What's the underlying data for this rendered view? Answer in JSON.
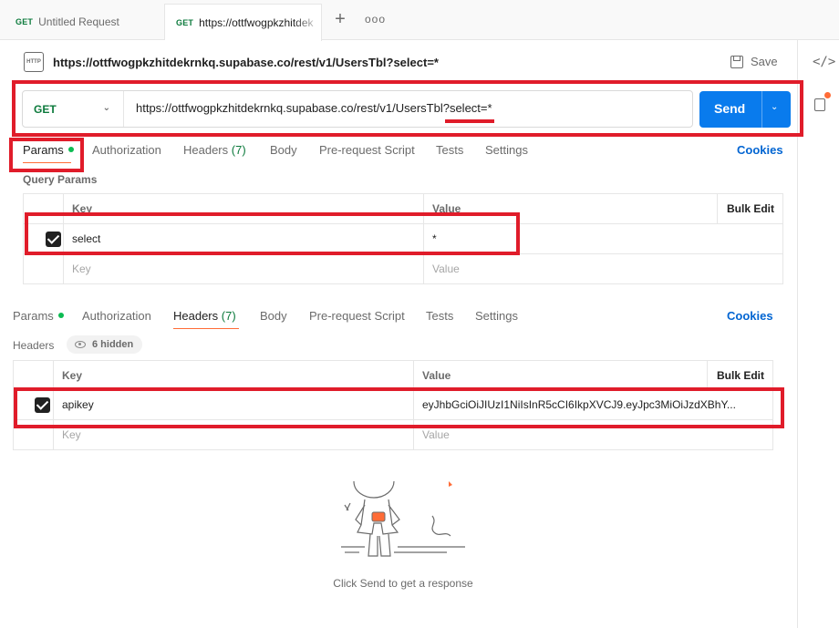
{
  "tabs": [
    {
      "method": "GET",
      "label": "Untitled Request"
    },
    {
      "method": "GET",
      "label": "https://ottfwogpkzhitdek"
    }
  ],
  "request": {
    "title": "https://ottfwogpkzhitdekrnkq.supabase.co/rest/v1/UsersTbl?select=*",
    "save_label": "Save",
    "method": "GET",
    "url": "https://ottfwogpkzhitdekrnkq.supabase.co/rest/v1/UsersTbl?select=*",
    "send_label": "Send"
  },
  "subtabs_top": {
    "params": "Params",
    "authorization": "Authorization",
    "headers": "Headers",
    "headers_count": "(7)",
    "body": "Body",
    "prerequest": "Pre-request Script",
    "tests": "Tests",
    "settings": "Settings",
    "cookies": "Cookies"
  },
  "query_params": {
    "section_label": "Query Params",
    "columns": {
      "key": "Key",
      "value": "Value",
      "bulk_edit": "Bulk Edit"
    },
    "rows": [
      {
        "enabled": true,
        "key": "select",
        "value": "*"
      }
    ],
    "placeholder": {
      "key": "Key",
      "value": "Value"
    }
  },
  "subtabs_bottom": {
    "params": "Params",
    "authorization": "Authorization",
    "headers": "Headers",
    "headers_count": "(7)",
    "body": "Body",
    "prerequest": "Pre-request Script",
    "tests": "Tests",
    "settings": "Settings",
    "cookies": "Cookies"
  },
  "headers": {
    "section_label": "Headers",
    "hidden_badge": "6 hidden",
    "columns": {
      "key": "Key",
      "value": "Value",
      "bulk_edit": "Bulk Edit"
    },
    "rows": [
      {
        "enabled": true,
        "key": "apikey",
        "value": "eyJhbGciOiJIUzI1NiIsInR5cCI6IkpXVCJ9.eyJpc3MiOiJzdXBhY..."
      }
    ],
    "placeholder": {
      "key": "Key",
      "value": "Value"
    }
  },
  "response": {
    "empty_message": "Click Send to get a response"
  },
  "colors": {
    "accent": "#097bed",
    "method_get": "#0c7a3c",
    "annotation": "#e01c2a",
    "active_underline": "#ff6c37",
    "cookies_link": "#0265d2"
  },
  "icons": [
    "plus-icon",
    "more-icon",
    "http-request-icon",
    "save-icon",
    "chevron-down-icon",
    "code-icon",
    "document-icon",
    "eye-icon",
    "checkbox-icon"
  ]
}
